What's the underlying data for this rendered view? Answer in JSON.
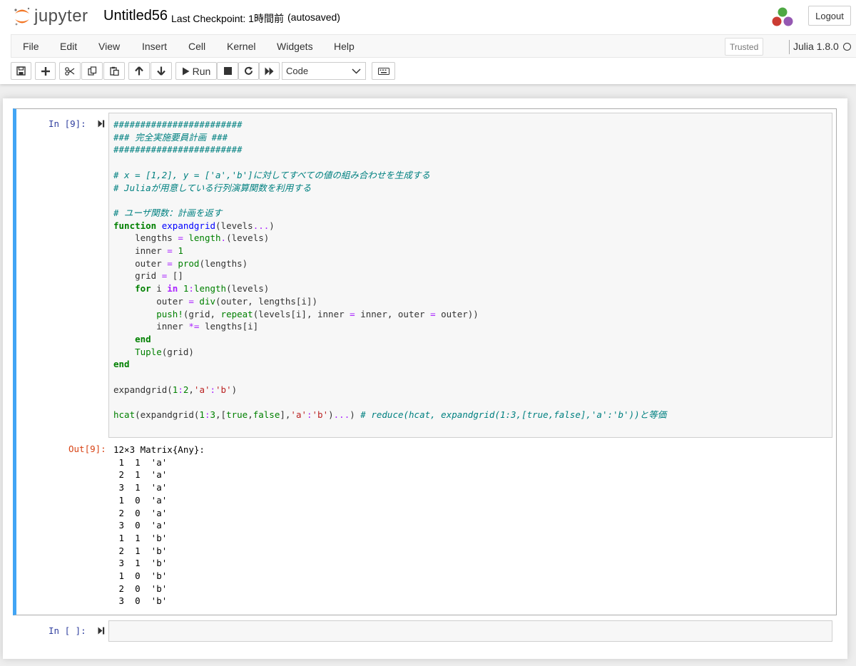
{
  "header": {
    "logo_text": "jupyter",
    "notebook_name": "Untitled56",
    "checkpoint": "Last Checkpoint: 1時間前",
    "autosave": "(autosaved)",
    "logout_label": "Logout"
  },
  "menubar": {
    "items": [
      "File",
      "Edit",
      "View",
      "Insert",
      "Cell",
      "Kernel",
      "Widgets",
      "Help"
    ],
    "trusted": "Trusted",
    "kernel_name": "Julia 1.8.0"
  },
  "toolbar": {
    "run_label": "Run",
    "cell_type": "Code",
    "cell_type_options": [
      "Code"
    ]
  },
  "cells": [
    {
      "in_prompt": "In [9]:",
      "out_prompt": "Out[9]:",
      "source": [
        "########################",
        "### 完全実施要員計画 ###",
        "########################",
        "",
        "# x = [1,2], y = ['a','b']に対してすべての値の組み合わせを生成する",
        "# Juliaが用意している行列演算関数を利用する",
        "",
        "# ユーザ関数：計画を返す",
        "function expandgrid(levels...)",
        "    lengths = length.(levels)",
        "    inner = 1",
        "    outer = prod(lengths)",
        "    grid = []",
        "    for i in 1:length(levels)",
        "        outer = div(outer, lengths[i])",
        "        push!(grid, repeat(levels[i], inner = inner, outer = outer))",
        "        inner *= lengths[i]",
        "    end",
        "    Tuple(grid)",
        "end",
        "",
        "expandgrid(1:2,'a':'b')",
        "",
        "hcat(expandgrid(1:3,[true,false],'a':'b')...) # reduce(hcat, expandgrid(1:3,[true,false],'a':'b'))と等価"
      ],
      "output": [
        "12×3 Matrix{Any}:",
        " 1  1  'a'",
        " 2  1  'a'",
        " 3  1  'a'",
        " 1  0  'a'",
        " 2  0  'a'",
        " 3  0  'a'",
        " 1  1  'b'",
        " 2  1  'b'",
        " 3  1  'b'",
        " 1  0  'b'",
        " 2  0  'b'",
        " 3  0  'b'"
      ]
    },
    {
      "in_prompt": "In [ ]:",
      "source": []
    }
  ],
  "colors": {
    "selected_cell_bar": "#42a5f5",
    "in_prompt": "#303f9f",
    "out_prompt": "#d84315",
    "kernel_logo": [
      "#4ea843",
      "#cb3c33",
      "#9558b2"
    ]
  },
  "icons": [
    "save-icon",
    "plus-icon",
    "cut-icon",
    "copy-icon",
    "paste-icon",
    "arrow-up-icon",
    "arrow-down-icon",
    "run-icon",
    "stop-icon",
    "restart-icon",
    "fast-forward-icon",
    "keyboard-icon",
    "chevron-down-icon",
    "kernel-idle-icon"
  ]
}
